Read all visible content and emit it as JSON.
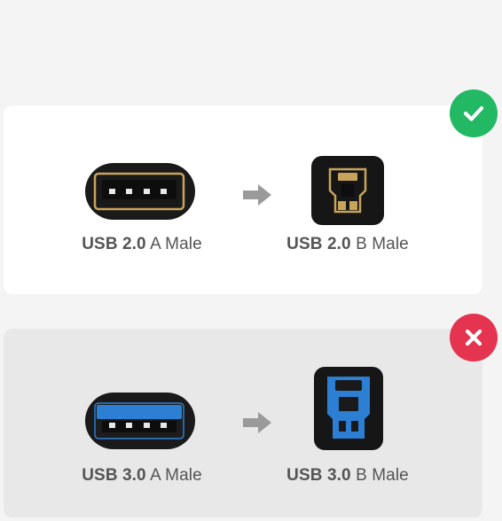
{
  "comparisons": [
    {
      "status": "compatible",
      "status_icon": "check-icon",
      "status_color": "#22b864",
      "source": {
        "version": "USB 2.0",
        "type": "A Male"
      },
      "target": {
        "version": "USB 2.0",
        "type": "B Male"
      },
      "insert_color": "#111111"
    },
    {
      "status": "incompatible",
      "status_icon": "x-icon",
      "status_color": "#e4344f",
      "source": {
        "version": "USB 3.0",
        "type": "A Male"
      },
      "target": {
        "version": "USB 3.0",
        "type": "B Male"
      },
      "insert_color": "#2d7fd3"
    }
  ]
}
